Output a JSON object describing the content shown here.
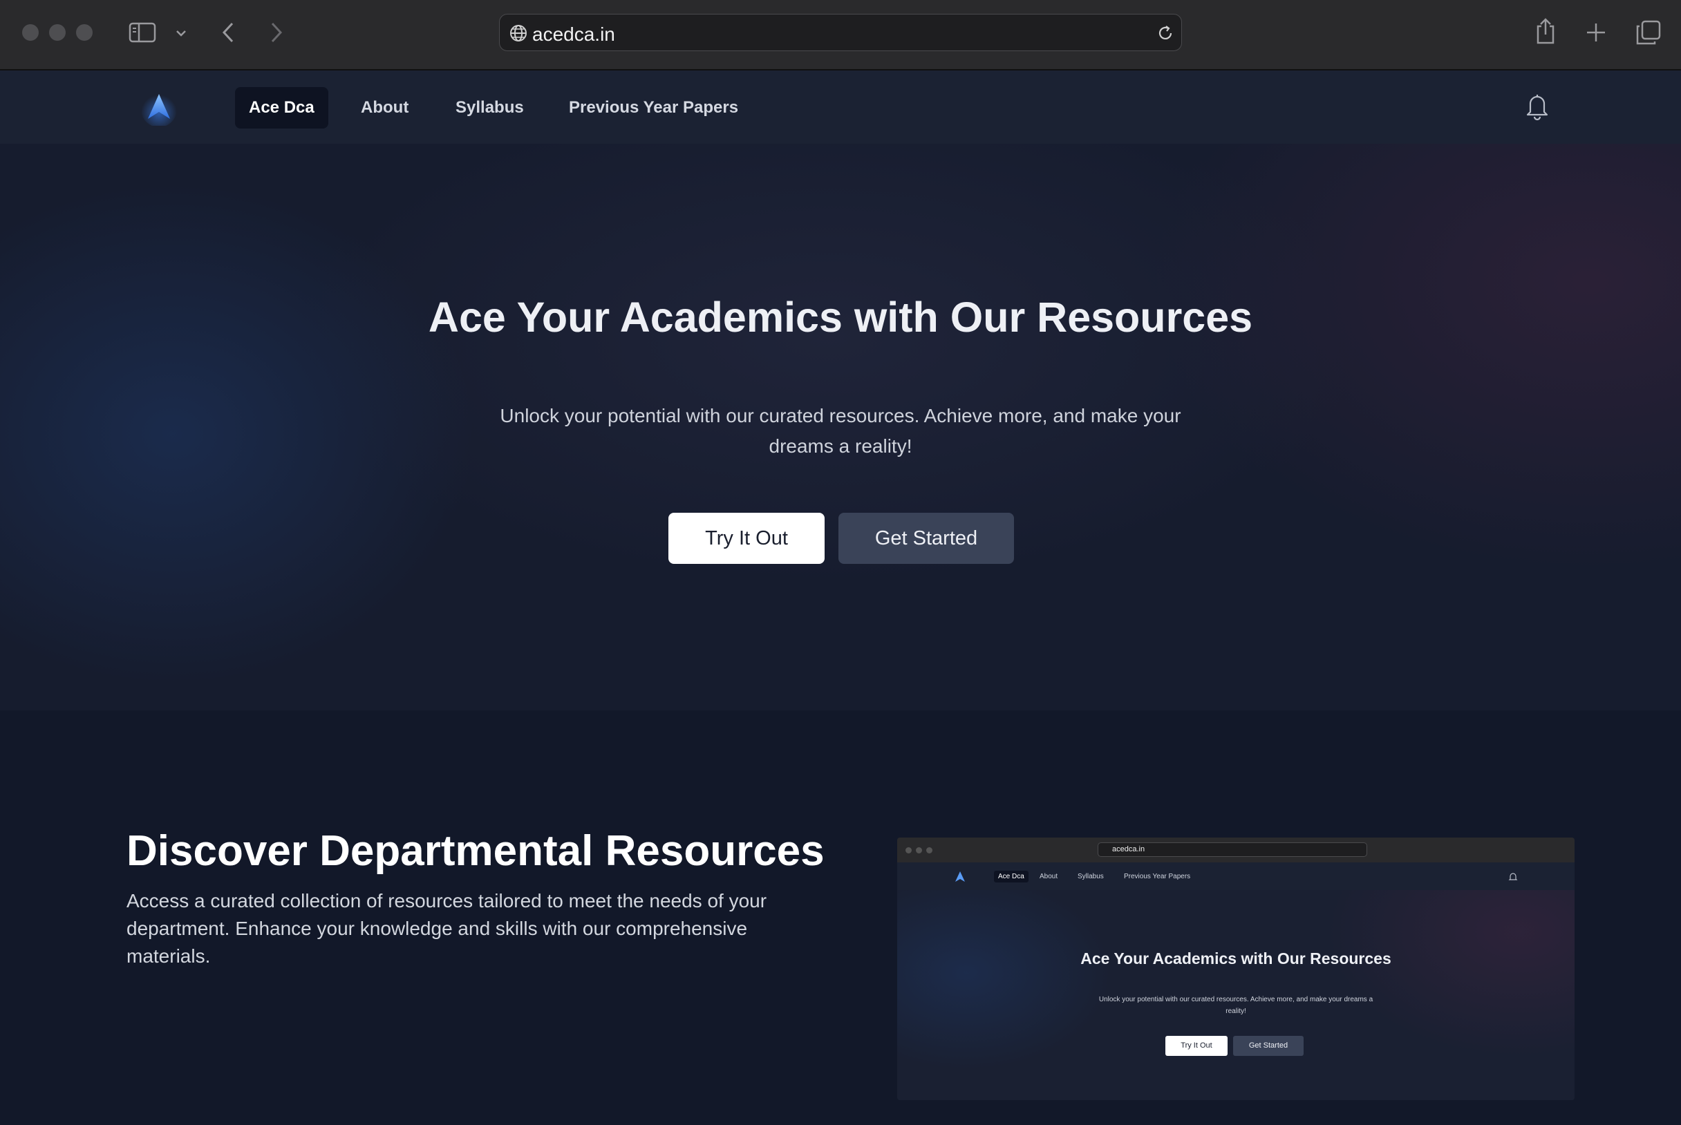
{
  "browser": {
    "url": "acedca.in",
    "icons": [
      "sidebar-toggle-icon",
      "chevron-down-icon",
      "back-arrow-icon",
      "forward-arrow-icon",
      "globe-icon",
      "reload-icon",
      "share-icon",
      "new-tab-icon",
      "tab-overview-icon"
    ]
  },
  "nav": {
    "items": [
      {
        "label": "Ace Dca",
        "active": true
      },
      {
        "label": "About"
      },
      {
        "label": "Syllabus"
      },
      {
        "label": "Previous Year Papers"
      }
    ],
    "icons": [
      "logo-icon",
      "bell-icon"
    ]
  },
  "hero": {
    "title": "Ace Your Academics with Our Resources",
    "subtitle": "Unlock your potential with our curated resources. Achieve more, and make your dreams a reality!",
    "try_label": "Try It Out",
    "start_label": "Get Started"
  },
  "section": {
    "title": "Discover Departmental Resources",
    "description": "Access a curated collection of resources tailored to meet the needs of your department. Enhance your knowledge and skills with our comprehensive materials."
  },
  "colors": {
    "accent": "#4a90f0",
    "background": "#141a2c",
    "nav_background": "#1b2233"
  }
}
